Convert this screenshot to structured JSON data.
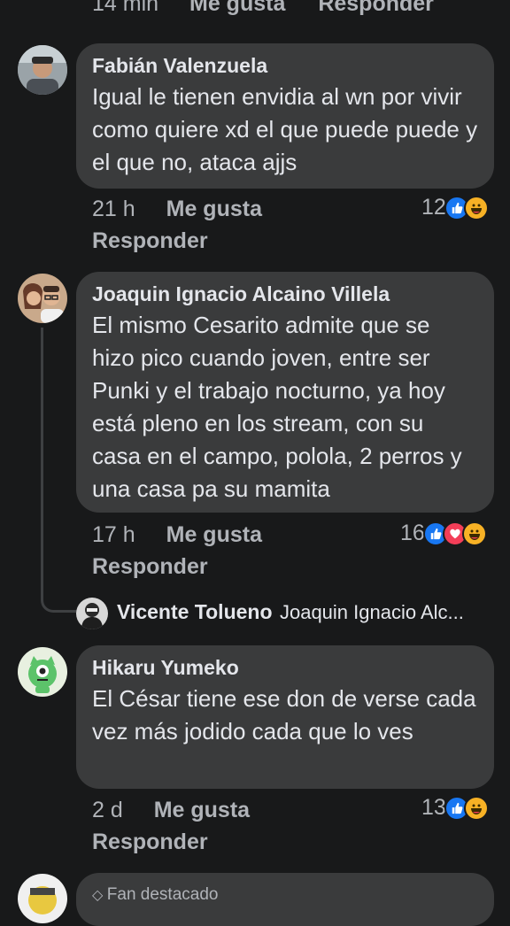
{
  "top_partial": {
    "time": "14 min",
    "like": "Me gusta",
    "reply": "Responder"
  },
  "comments": [
    {
      "author": "Fabián Valenzuela",
      "text": "Igual le tienen envidia al wn por vivir como quiere xd el que puede puede y el que no, ataca ajjs",
      "time": "21 h",
      "like": "Me gusta",
      "reply": "Responder",
      "reaction_count": "12",
      "reactions": [
        "like",
        "haha"
      ]
    },
    {
      "author": "Joaquin Ignacio Alcaino Villela",
      "text": "El mismo Cesarito admite que se hizo pico cuando joven, entre ser Punki y el trabajo nocturno, ya hoy está pleno en los stream, con su casa en el campo, polola, 2 perros y una casa pa su mamita",
      "time": "17 h",
      "like": "Me gusta",
      "reply": "Responder",
      "reaction_count": "16",
      "reactions": [
        "like",
        "love",
        "haha"
      ]
    },
    {
      "author": "Hikaru Yumeko",
      "text": "El César tiene ese don de verse cada vez más jodido cada que lo ves",
      "time": "2 d",
      "like": "Me gusta",
      "reply": "Responder",
      "reaction_count": "13",
      "reactions": [
        "like",
        "haha"
      ]
    }
  ],
  "reply_preview": {
    "author": "Vicente Tolueno",
    "text": "Joaquin Ignacio Alc..."
  },
  "bottom_partial": {
    "badge": "Fan destacado"
  },
  "colors": {
    "background": "#18191a",
    "bubble": "#3a3b3c",
    "like": "#1877f2",
    "love": "#f33e58",
    "haha": "#f7b125"
  }
}
